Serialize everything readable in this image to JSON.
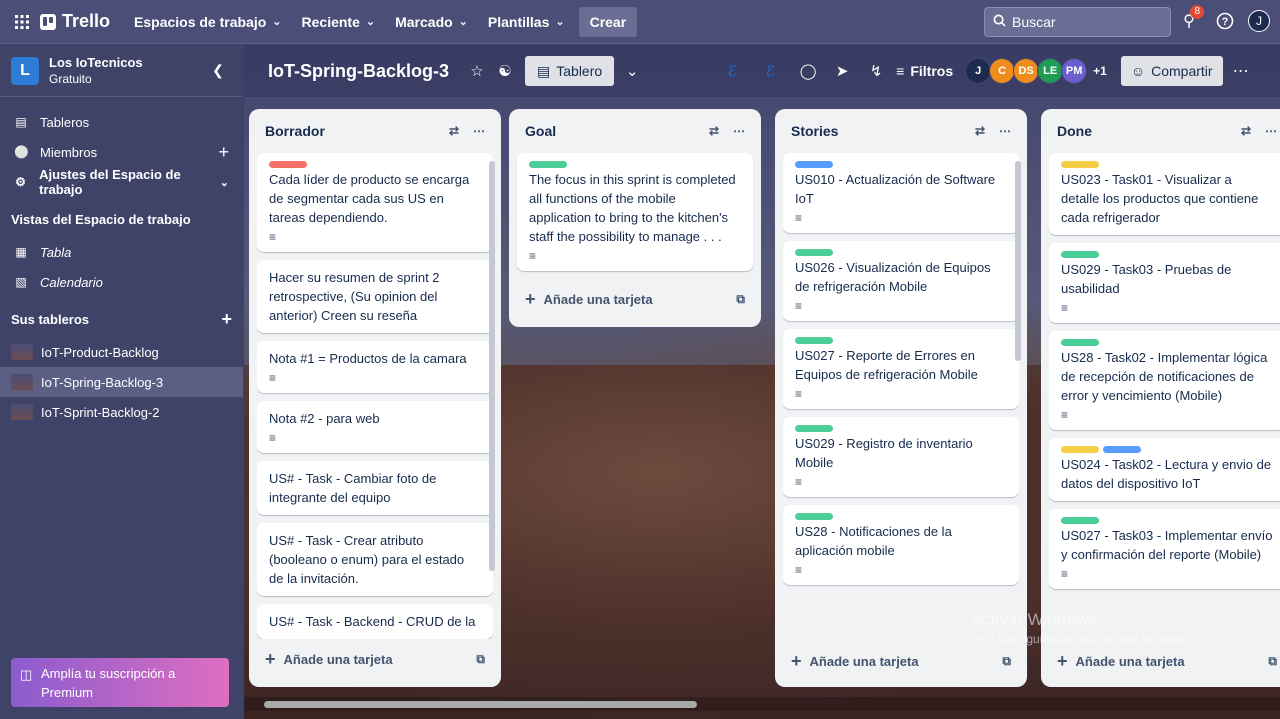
{
  "topnav": {
    "logo": "Trello",
    "menus": [
      "Espacios de trabajo",
      "Reciente",
      "Marcado",
      "Plantillas"
    ],
    "create_label": "Crear",
    "search_placeholder": "Buscar",
    "notifications_count": "8",
    "user_initial": "J"
  },
  "sidebar": {
    "workspace_initial": "L",
    "workspace_name": "Los IoTecnicos",
    "workspace_plan": "Gratuito",
    "items": [
      {
        "label": "Tableros",
        "icon": "board-icon"
      },
      {
        "label": "Miembros",
        "icon": "member-icon"
      },
      {
        "label": "Ajustes del Espacio de trabajo",
        "icon": "gear-icon"
      }
    ],
    "views_heading": "Vistas del Espacio de trabajo",
    "views": [
      {
        "label": "Tabla",
        "icon": "table-icon"
      },
      {
        "label": "Calendario",
        "icon": "calendar-icon"
      }
    ],
    "boards_heading": "Sus tableros",
    "boards": [
      "IoT-Product-Backlog",
      "IoT-Spring-Backlog-3",
      "IoT-Sprint-Backlog-2"
    ],
    "upgrade_text": "Amplía tu suscripción a Premium"
  },
  "board": {
    "title": "IoT-Spring-Backlog-3",
    "view_label": "Tablero",
    "filters_label": "Filtros",
    "members": [
      {
        "initials": "J",
        "color": "#1d2b4f"
      },
      {
        "initials": "C",
        "color": "#f08c1e"
      },
      {
        "initials": "DS",
        "color": "#f08c1e"
      },
      {
        "initials": "LE",
        "color": "#1f9d55"
      },
      {
        "initials": "PM",
        "color": "#6b5ecf"
      }
    ],
    "members_more": "+1",
    "share_label": "Compartir",
    "add_card_label": "Añade una tarjeta"
  },
  "lists": [
    {
      "title": "Borrador",
      "cards": [
        {
          "labels": [
            "#f87168"
          ],
          "text": "Cada líder de producto se encarga de segmentar cada sus US en tareas dependiendo.",
          "desc": true
        },
        {
          "labels": [],
          "text": "Hacer su resumen de sprint 2 retrospective, (Su opinion del anterior) Creen su reseña",
          "desc": false
        },
        {
          "labels": [],
          "text": "Nota #1 = Productos de la camara",
          "desc": true
        },
        {
          "labels": [],
          "text": "Nota #2 - para web",
          "desc": true
        },
        {
          "labels": [],
          "text": "US# - Task - Cambiar foto de integrante del equipo",
          "desc": false
        },
        {
          "labels": [],
          "text": "US# - Task - Crear atributo (booleano o enum) para el estado de la invitación.",
          "desc": false
        },
        {
          "labels": [],
          "text": "US# - Task - Backend - CRUD de la",
          "desc": false
        }
      ]
    },
    {
      "title": "Goal",
      "cards": [
        {
          "labels": [
            "#4bce97"
          ],
          "text": "The focus in this sprint is completed all functions of the mobile application to bring to the kitchen's staff the possibility to manage . . .",
          "desc": true
        }
      ]
    },
    {
      "title": "Stories",
      "cards": [
        {
          "labels": [
            "#579dff"
          ],
          "text": "US010 - Actualización de Software IoT",
          "desc": true
        },
        {
          "labels": [
            "#4bce97"
          ],
          "text": "US026 - Visualización de Equipos de refrigeración Mobile",
          "desc": true
        },
        {
          "labels": [
            "#4bce97"
          ],
          "text": "US027 - Reporte de Errores en Equipos de refrigeración Mobile",
          "desc": true
        },
        {
          "labels": [
            "#4bce97"
          ],
          "text": "US029 - Registro de inventario Mobile",
          "desc": true
        },
        {
          "labels": [
            "#4bce97"
          ],
          "text": "US28 - Notificaciones de la aplicación mobile",
          "desc": true
        }
      ]
    },
    {
      "title": "Done",
      "cards": [
        {
          "labels": [
            "#f5cd47"
          ],
          "text": "US023 - Task01 - Visualizar a detalle los productos que contiene cada refrigerador",
          "desc": false
        },
        {
          "labels": [
            "#4bce97"
          ],
          "text": "US029 - Task03 - Pruebas de usabilidad",
          "desc": true
        },
        {
          "labels": [
            "#4bce97"
          ],
          "text": "US28 - Task02 - Implementar lógica de recepción de notificaciones de error y vencimiento (Mobile)",
          "desc": true
        },
        {
          "labels": [
            "#f5cd47",
            "#579dff"
          ],
          "text": "US024 - Task02 - Lectura y envio de datos del dispositivo IoT",
          "desc": false
        },
        {
          "labels": [
            "#4bce97"
          ],
          "text": "US027 - Task03 - Implementar envío y confirmación del reporte (Mobile)",
          "desc": true
        }
      ]
    }
  ],
  "watermark": {
    "line1": "Activar Windows",
    "line2": "Ve a Configuración para activar Windows."
  }
}
